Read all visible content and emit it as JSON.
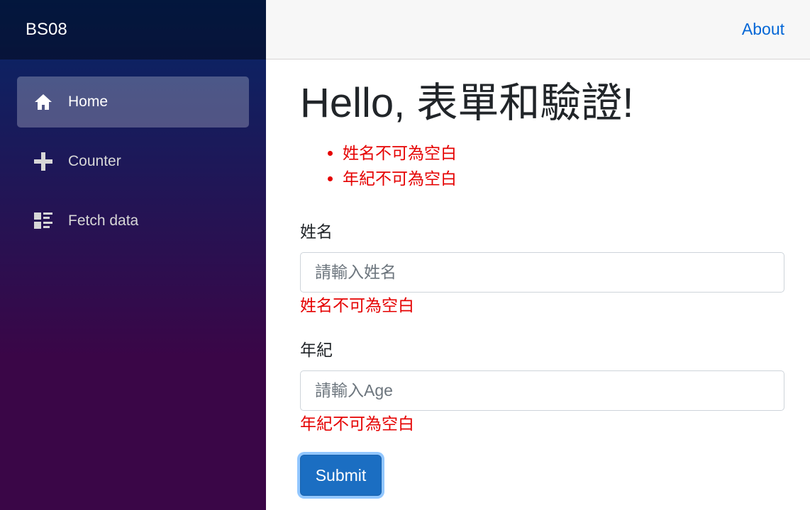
{
  "app": {
    "brand": "BS08"
  },
  "sidebar": {
    "items": [
      {
        "label": "Home",
        "icon": "home-icon",
        "active": true
      },
      {
        "label": "Counter",
        "icon": "plus-icon",
        "active": false
      },
      {
        "label": "Fetch data",
        "icon": "list-rich-icon",
        "active": false
      }
    ]
  },
  "topbar": {
    "about_label": "About"
  },
  "main": {
    "title": "Hello, 表單和驗證!",
    "validation_summary": [
      "姓名不可為空白",
      "年紀不可為空白"
    ],
    "name_field": {
      "label": "姓名",
      "value": "",
      "placeholder": "請輸入姓名",
      "error": "姓名不可為空白"
    },
    "age_field": {
      "label": "年紀",
      "value": "",
      "placeholder": "請輸入Age",
      "error": "年紀不可為空白"
    },
    "submit_label": "Submit"
  },
  "colors": {
    "sidebar_gradient_top": "#052767",
    "sidebar_gradient_bottom": "#3a0647",
    "error": "#e50000",
    "link": "#0366d6",
    "button": "#1b6ec2"
  }
}
